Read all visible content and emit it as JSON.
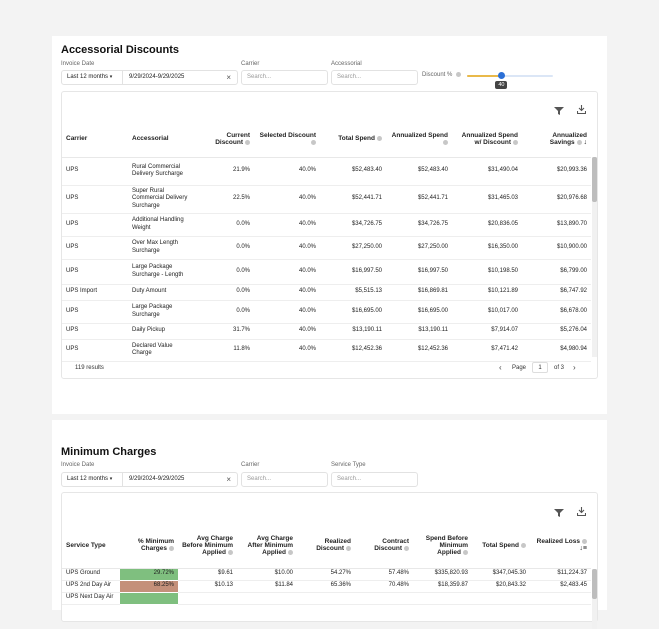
{
  "accessorial": {
    "title": "Accessorial Discounts",
    "filters": {
      "invoice_date_label": "Invoice Date",
      "date_preset": "Last 12 months",
      "date_range": "9/29/2024-9/29/2025",
      "carrier_label": "Carrier",
      "carrier_placeholder": "Search...",
      "accessorial_label": "Accessorial",
      "accessorial_placeholder": "Search...",
      "discount_label": "Discount %",
      "discount_value": "40",
      "discount_fraction": 0.4
    },
    "columns": [
      "Carrier",
      "Accessorial",
      "Current Discount",
      "Selected Discount",
      "Total Spend",
      "Annualized Spend",
      "Annualized Spend w/ Discount",
      "Annualized Savings"
    ],
    "rows": [
      [
        "UPS",
        "Rural Commercial Delivery Surcharge",
        "21.9%",
        "40.0%",
        "$52,483.40",
        "$52,483.40",
        "$31,490.04",
        "$20,993.36"
      ],
      [
        "UPS",
        "Super Rural Commercial Delivery Surcharge",
        "22.5%",
        "40.0%",
        "$52,441.71",
        "$52,441.71",
        "$31,465.03",
        "$20,976.68"
      ],
      [
        "UPS",
        "Additional Handling Weight",
        "0.0%",
        "40.0%",
        "$34,726.75",
        "$34,726.75",
        "$20,836.05",
        "$13,890.70"
      ],
      [
        "UPS",
        "Over Max Length Surcharge",
        "0.0%",
        "40.0%",
        "$27,250.00",
        "$27,250.00",
        "$16,350.00",
        "$10,900.00"
      ],
      [
        "UPS",
        "Large Package Surcharge - Length",
        "0.0%",
        "40.0%",
        "$16,997.50",
        "$16,997.50",
        "$10,198.50",
        "$6,799.00"
      ],
      [
        "UPS Import",
        "Duty Amount",
        "0.0%",
        "40.0%",
        "$5,515.13",
        "$16,869.81",
        "$10,121.89",
        "$6,747.92"
      ],
      [
        "UPS",
        "Large Package Surcharge",
        "0.0%",
        "40.0%",
        "$16,695.00",
        "$16,695.00",
        "$10,017.00",
        "$6,678.00"
      ],
      [
        "UPS",
        "Daily Pickup",
        "31.7%",
        "40.0%",
        "$13,190.11",
        "$13,190.11",
        "$7,914.07",
        "$5,276.04"
      ],
      [
        "UPS",
        "Declared Value Charge",
        "11.8%",
        "40.0%",
        "$12,452.36",
        "$12,452.36",
        "$7,471.42",
        "$4,980.94"
      ]
    ],
    "results": "119 results",
    "page_label": "Page",
    "page_value": "1",
    "page_of": "of 3"
  },
  "minimum": {
    "title": "Minimum Charges",
    "filters": {
      "invoice_date_label": "Invoice Date",
      "date_preset": "Last 12 months",
      "date_range": "9/29/2024-9/29/2025",
      "carrier_label": "Carrier",
      "carrier_placeholder": "Search...",
      "service_label": "Service Type",
      "service_placeholder": "Search..."
    },
    "columns": [
      "Service Type",
      "% Minimum Charges",
      "Avg Charge Before Minimum Applied",
      "Avg Charge After Minimum Applied",
      "Realized Discount",
      "Contract Discount",
      "Spend Before Minimum Applied",
      "Total Spend",
      "Realized Loss"
    ],
    "rows": [
      [
        "UPS Ground",
        "29.72%",
        "$9.61",
        "$10.00",
        "54.27%",
        "57.48%",
        "$335,820.93",
        "$347,045.30",
        "$11,224.37"
      ],
      [
        "UPS 2nd Day Air",
        "68.25%",
        "$10.13",
        "$11.84",
        "65.36%",
        "70.48%",
        "$18,359.87",
        "$20,843.32",
        "$2,483.45"
      ],
      [
        "UPS Next Day Air",
        "",
        "",
        "",
        "",
        "",
        "",
        "",
        ""
      ]
    ],
    "row_colors": [
      "#7fbf7f",
      "#c4907a",
      "#7fbf7f"
    ]
  }
}
